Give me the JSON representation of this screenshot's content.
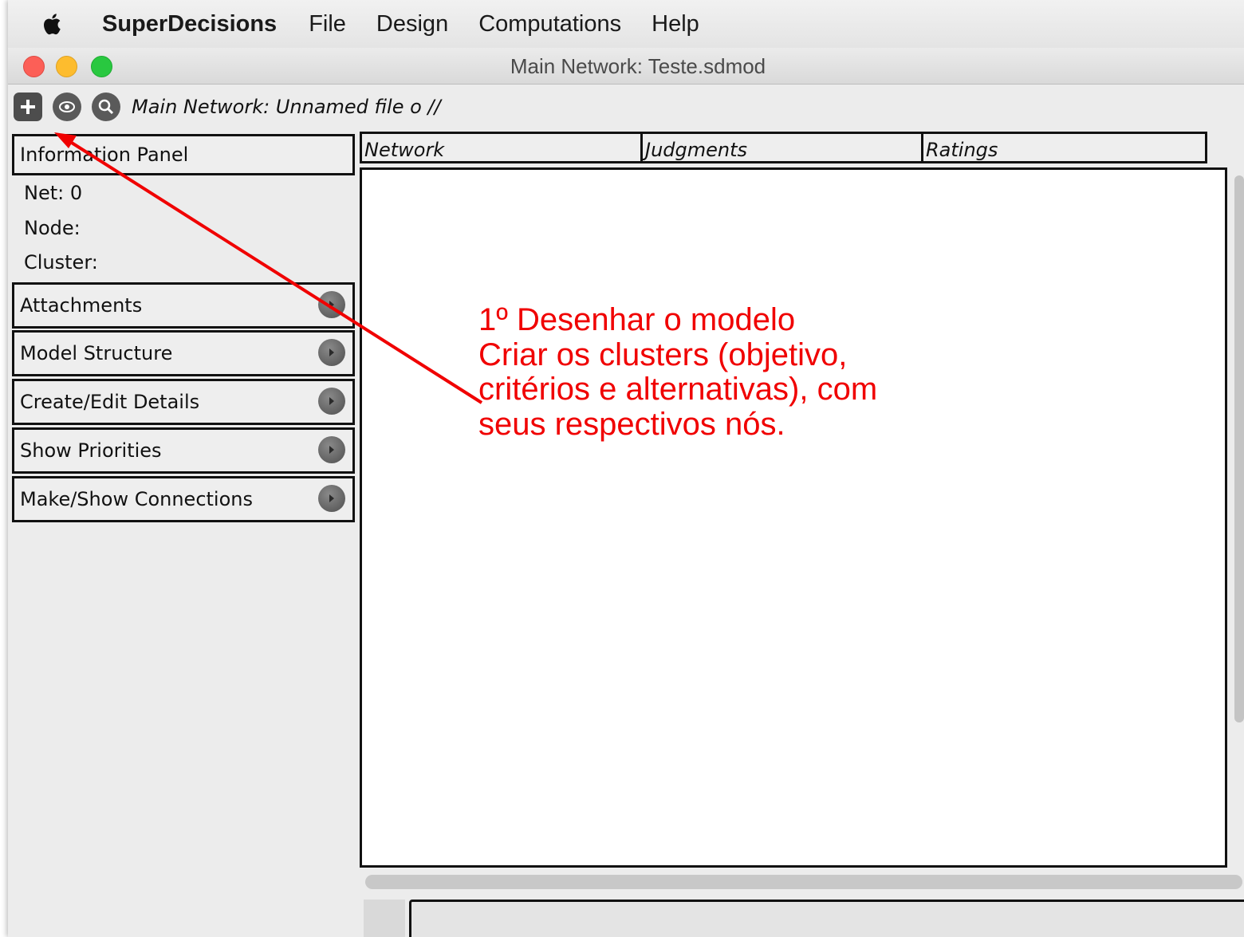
{
  "menubar": {
    "app_name": "SuperDecisions",
    "items": [
      "File",
      "Design",
      "Computations",
      "Help"
    ]
  },
  "window": {
    "title": "Main Network: Teste.sdmod"
  },
  "toolbar": {
    "buttons": [
      "plus-icon",
      "eye-icon",
      "search-icon"
    ],
    "path_label": "Main Network: Unnamed file o //"
  },
  "left_panel": {
    "information_panel": "Information Panel",
    "net_label": "Net: 0",
    "node_label": "Node:",
    "cluster_label": "Cluster:",
    "sections": [
      "Attachments",
      "Model Structure",
      "Create/Edit Details",
      "Show Priorities",
      "Make/Show Connections"
    ]
  },
  "tabs": [
    "Network",
    "Judgments",
    "Ratings"
  ],
  "annotation": {
    "lines": [
      "1º Desenhar o modelo",
      "Criar os clusters (objetivo,",
      "critérios e alternativas), com",
      "seus respectivos nós."
    ],
    "color": "#f00000"
  }
}
